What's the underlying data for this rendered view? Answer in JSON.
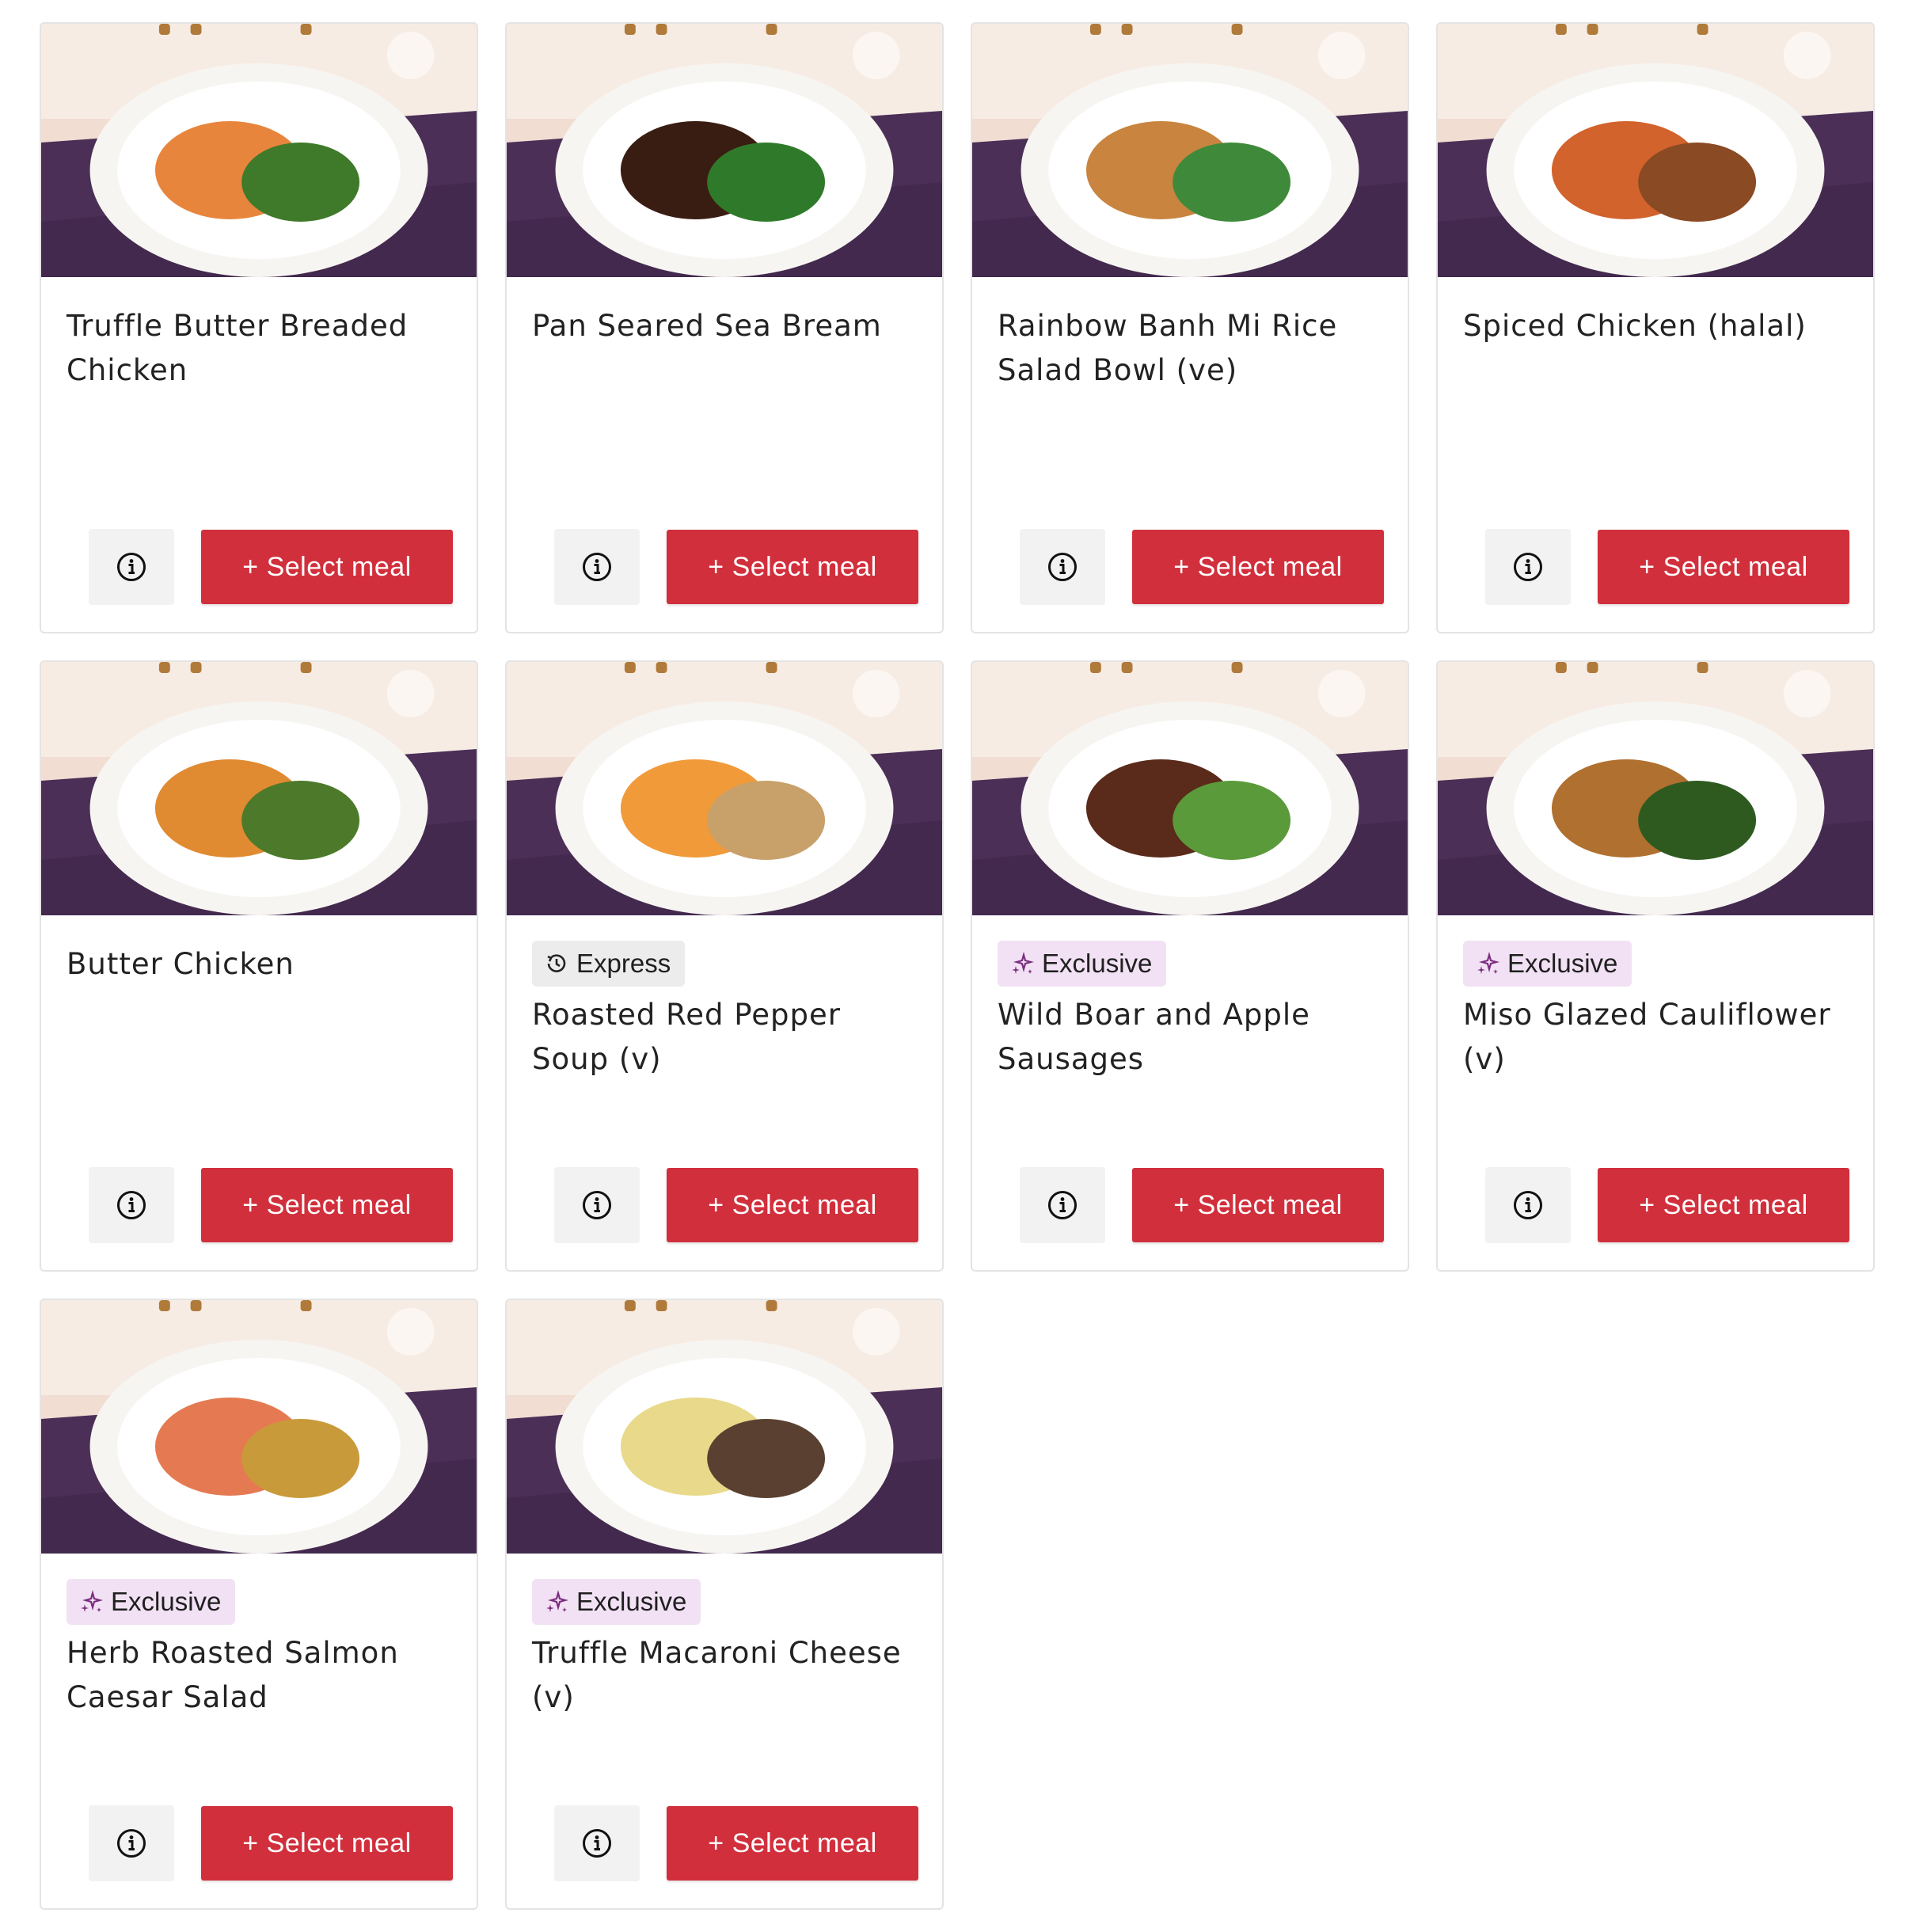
{
  "colors": {
    "select_button": "#d12f3c",
    "express_badge": "#ececec",
    "exclusive_badge": "#f2e1f4",
    "exclusive_icon": "#7b2d7f"
  },
  "icons": {
    "info": "info-circle-icon",
    "express": "clock-express-icon",
    "exclusive": "sparkle-icon"
  },
  "meals": [
    {
      "title": "Truffle Butter Breaded Chicken",
      "badge": null,
      "select_label": "+ Select meal",
      "plate": "#e8853d",
      "plate2": "#3f7a2a"
    },
    {
      "title": "Pan Seared Sea Bream",
      "badge": null,
      "select_label": "+ Select meal",
      "plate": "#3a1d12",
      "plate2": "#2f7a2a"
    },
    {
      "title": "Rainbow Banh Mi Rice Salad Bowl (ve)",
      "badge": null,
      "select_label": "+ Select meal",
      "plate": "#c9843f",
      "plate2": "#3f8a3a"
    },
    {
      "title": "Spiced Chicken (halal)",
      "badge": null,
      "select_label": "+ Select meal",
      "plate": "#d2632d",
      "plate2": "#8a4a23"
    },
    {
      "title": "Butter Chicken",
      "badge": null,
      "select_label": "+ Select meal",
      "plate": "#e08a32",
      "plate2": "#4d7a2a"
    },
    {
      "title": "Roasted Red Pepper Soup (v)",
      "badge": {
        "type": "express",
        "label": "Express"
      },
      "select_label": "+ Select meal",
      "plate": "#f09a3a",
      "plate2": "#c8a06a"
    },
    {
      "title": "Wild Boar and Apple Sausages",
      "badge": {
        "type": "exclusive",
        "label": "Exclusive"
      },
      "select_label": "+ Select meal",
      "plate": "#5a2a1a",
      "plate2": "#5a9a3a"
    },
    {
      "title": "Miso Glazed Cauliflower (v)",
      "badge": {
        "type": "exclusive",
        "label": "Exclusive"
      },
      "select_label": "+ Select meal",
      "plate": "#b0702f",
      "plate2": "#2e5a20"
    },
    {
      "title": "Herb Roasted Salmon Caesar Salad",
      "badge": {
        "type": "exclusive",
        "label": "Exclusive"
      },
      "select_label": "+ Select meal",
      "plate": "#e57a52",
      "plate2": "#c99a3a"
    },
    {
      "title": "Truffle Macaroni Cheese (v)",
      "badge": {
        "type": "exclusive",
        "label": "Exclusive"
      },
      "select_label": "+ Select meal",
      "plate": "#e9d98a",
      "plate2": "#5a4030"
    }
  ]
}
